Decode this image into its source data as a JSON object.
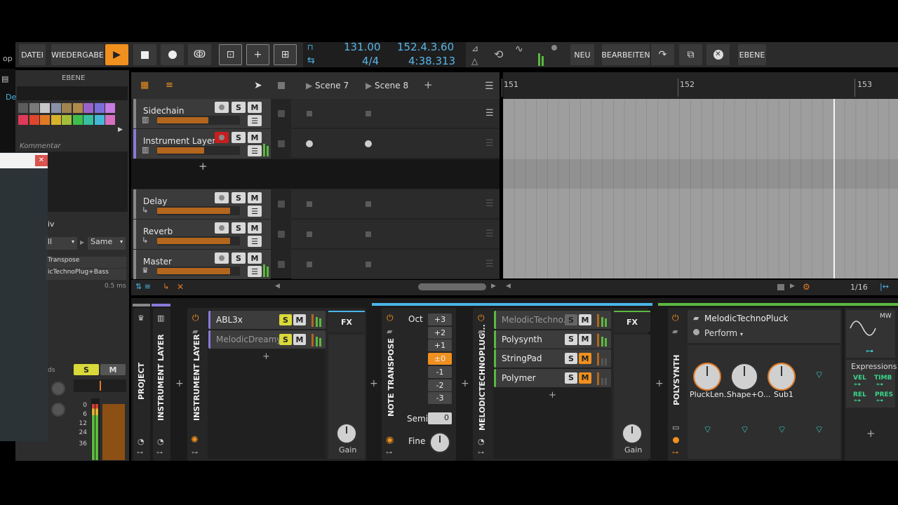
{
  "toolbar": {
    "file": "DATEI",
    "playback": "WIEDERGABE",
    "tempo": "131.00",
    "signature": "4/4",
    "position": "152.4.3.60",
    "time": "4:38.313",
    "new": "NEU",
    "edit": "BEARBEITEN",
    "layer": "EBENE"
  },
  "left": {
    "header": "EBENE",
    "comment": "Kommentar",
    "frag_op": "op",
    "frag_de": "De",
    "frag_iv": "iv",
    "all": "ll",
    "same": "Same",
    "item1": "Transpose",
    "item2": "icTechnoPlug+Bass",
    "ms": "0.5 ms",
    "ds": "ds",
    "s": "S",
    "m": "M",
    "scale": [
      "0",
      "6",
      "12",
      "24",
      "36"
    ],
    "colors": [
      "#5c5c5c",
      "#7a7a7a",
      "#c8c8c8",
      "#8891a8",
      "#a0834f",
      "#b08a4a",
      "#9b63c9",
      "#7a6fd9",
      "#c87be0",
      "#e03a5a",
      "#e0452e",
      "#e07a25",
      "#d8b32a",
      "#a2be3a",
      "#3fbf4a",
      "#36c0a0",
      "#45b8d8",
      "#d870c0"
    ]
  },
  "launcher": {
    "scenes": [
      "Scene 7",
      "Scene 8"
    ],
    "tracks": [
      {
        "name": "Sidechain",
        "vol": 0.62
      },
      {
        "name": "Instrument Layer",
        "vol": 0.57
      },
      {
        "name": "Delay",
        "vol": 0.88
      },
      {
        "name": "Reverb",
        "vol": 0.88
      },
      {
        "name": "Master",
        "vol": 0.88
      }
    ],
    "s": "S",
    "m": "M",
    "zoom": "1/16"
  },
  "arranger": {
    "bars": [
      "151",
      "152",
      "153"
    ]
  },
  "devices": {
    "project": "PROJECT",
    "instrument_layer_a": "INSTRUMENT LAYER",
    "instrument_layer_b": "INSTRUMENT LAYER",
    "chains_a": [
      "ABL3x",
      "MelodicDreamy..."
    ],
    "fx": "FX",
    "gain": "Gain",
    "note_transpose": "NOTE TRANSPOSE",
    "oct": "Oct",
    "oct_values": [
      "+3",
      "+2",
      "+1",
      "±0",
      "-1",
      "-2",
      "-3"
    ],
    "semi": "Semi",
    "semi_value": "0",
    "fine": "Fine",
    "melodic_label": "MELODICTECHNOPLUG...",
    "chains_b": [
      "MelodicTechno...",
      "Polysynth",
      "StringPad",
      "Polymer"
    ],
    "polysynth": "POLYSYNTH",
    "preset": "MelodicTechnoPluck",
    "perform": "Perform",
    "knobs": [
      "PluckLen...",
      "Shape+O...",
      "Sub1"
    ],
    "mw": "MW",
    "expressions": "Expressions",
    "vel": "VEL",
    "timb": "TIMB",
    "rel": "REL",
    "pres": "PRES",
    "s": "S",
    "m": "M"
  }
}
